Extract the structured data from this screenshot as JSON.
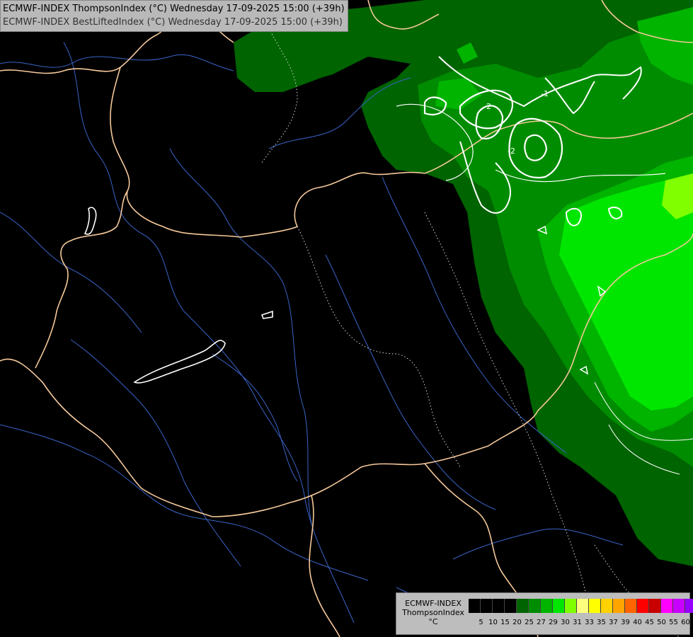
{
  "header": {
    "line1": "ECMWF-INDEX ThompsonIndex (°C) Wednesday 17-09-2025 15:00 (+39h)",
    "line2": "ECMWF-INDEX BestLiftedIndex (°C) Wednesday 17-09-2025 15:00 (+39h)"
  },
  "legend": {
    "line1": "ECMWF-INDEX",
    "line2": "ThompsonIndex",
    "unit": "°C",
    "colors": [
      "#000000",
      "#000000",
      "#000000",
      "#000000",
      "#006400",
      "#008c00",
      "#00b400",
      "#00e600",
      "#7fff00",
      "#ffff7f",
      "#ffff00",
      "#ffd200",
      "#ffa500",
      "#ff6400",
      "#ff0000",
      "#c80000",
      "#ff00ff",
      "#c800ff",
      "#9600ff",
      "#6400ff",
      "#0000ff"
    ],
    "ticks": [
      "5",
      "10",
      "15",
      "20",
      "25",
      "27",
      "29",
      "30",
      "31",
      "33",
      "35",
      "37",
      "39",
      "40",
      "45",
      "50",
      "55",
      "60"
    ]
  },
  "contour_labels": [
    "-1",
    "-2",
    "-2"
  ]
}
